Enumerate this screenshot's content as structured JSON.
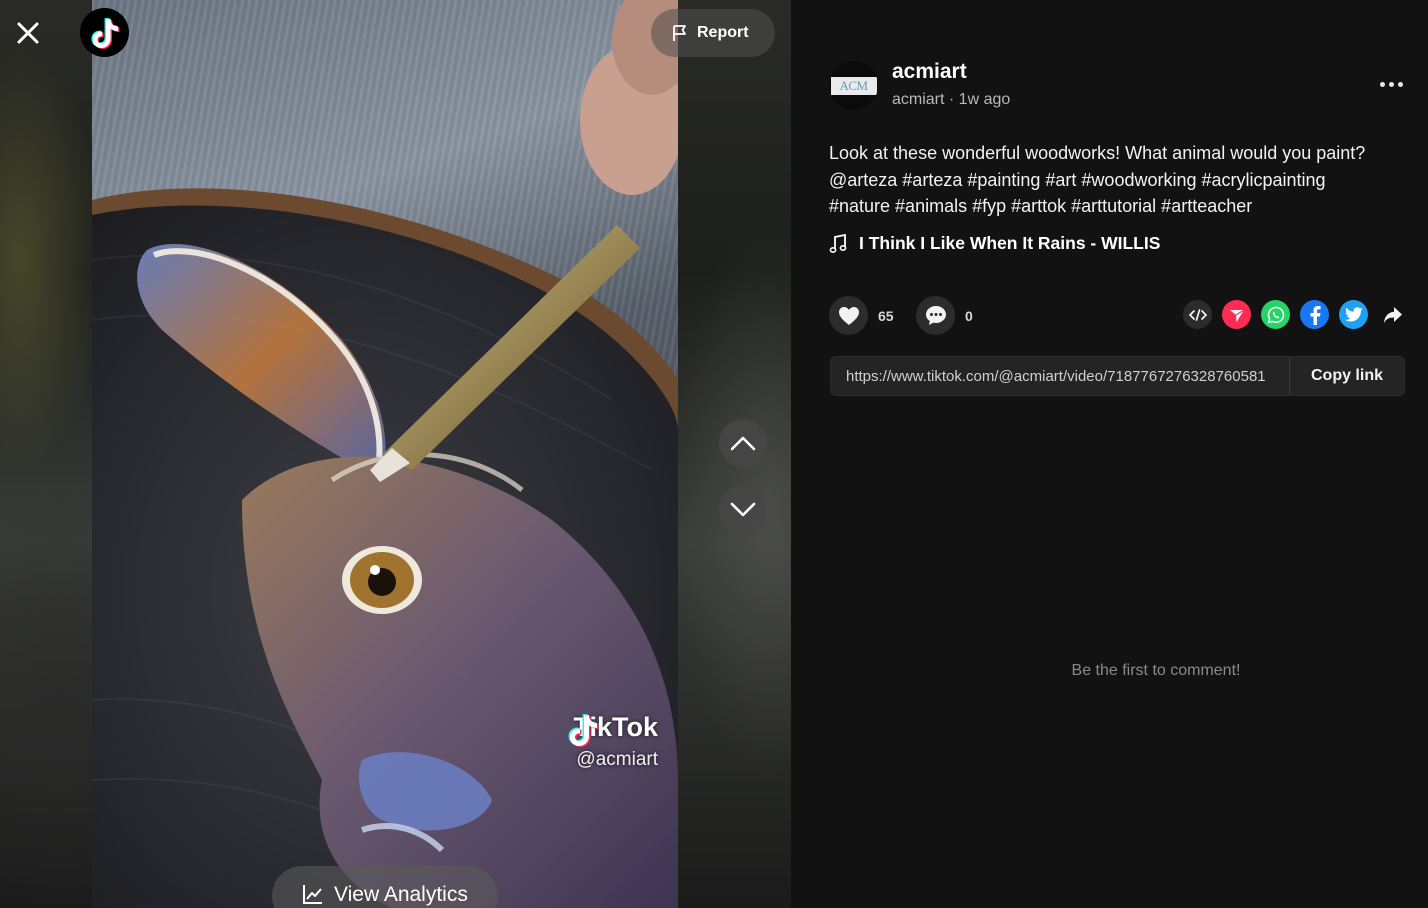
{
  "video": {
    "watermark_brand": "TikTok",
    "watermark_handle": "@acmiart",
    "report_label": "Report",
    "analytics_label": "View Analytics"
  },
  "author": {
    "avatar_text": "ACM",
    "username": "acmiart",
    "handle": "acmiart",
    "time_ago": "1w ago",
    "meta_separator": " · "
  },
  "post": {
    "caption_line1": "Look at these wonderful woodworks! What animal would you paint?",
    "caption_line2": "@arteza #arteza #painting #art #woodworking #acrylicpainting",
    "caption_line3": "#nature #animals #fyp #arttok #arttutorial #artteacher",
    "music": "I Think I Like When It Rains - WILLIS"
  },
  "actions": {
    "likes": "65",
    "comments": "0"
  },
  "share": {
    "icons": [
      "embed-icon",
      "send-to-friends-icon",
      "whatsapp-icon",
      "facebook-icon",
      "twitter-icon",
      "share-arrow-icon"
    ],
    "link_url": "https://www.tiktok.com/@acmiart/video/7187767276328760581",
    "copy_label": "Copy link"
  },
  "comments": {
    "empty_text": "Be the first to comment!"
  },
  "colors": {
    "panel_bg": "#121212",
    "tiktok_red": "#fe2c55",
    "tiktok_cyan": "#25f4ee",
    "whatsapp": "#25d366",
    "facebook": "#1877f2",
    "twitter": "#1da1f2"
  }
}
